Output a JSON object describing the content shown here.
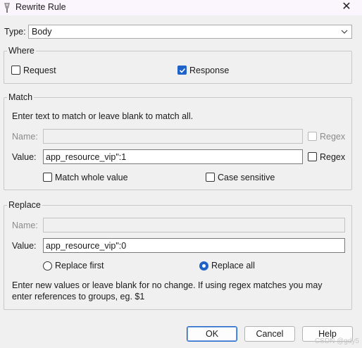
{
  "window": {
    "title": "Rewrite Rule",
    "close_glyph": "✕"
  },
  "type": {
    "label": "Type:",
    "value": "Body"
  },
  "where": {
    "legend": "Where",
    "request": {
      "label": "Request",
      "checked": false
    },
    "response": {
      "label": "Response",
      "checked": true
    }
  },
  "match": {
    "legend": "Match",
    "hint": "Enter text to match or leave blank to match all.",
    "name_label": "Name:",
    "name_value": "",
    "name_regex": {
      "label": "Regex",
      "checked": false,
      "enabled": false
    },
    "value_label": "Value:",
    "value_value": "app_resource_vip\":1",
    "value_regex": {
      "label": "Regex",
      "checked": false
    },
    "whole_value": {
      "label": "Match whole value",
      "checked": false
    },
    "case_sensitive": {
      "label": "Case sensitive",
      "checked": false
    }
  },
  "replace": {
    "legend": "Replace",
    "name_label": "Name:",
    "name_value": "",
    "value_label": "Value:",
    "value_value": "app_resource_vip\":0",
    "replace_first": {
      "label": "Replace first",
      "selected": false
    },
    "replace_all": {
      "label": "Replace all",
      "selected": true
    },
    "hint_line1": "Enter new values or leave blank for no change. If using regex matches you may",
    "hint_line2": "enter references to groups, eg. $1"
  },
  "buttons": {
    "ok": "OK",
    "cancel": "Cancel",
    "help": "Help"
  },
  "watermark": "CSDN @gdy5",
  "colors": {
    "accent": "#1f63c8",
    "background": "#f0f0f0",
    "titlebar": "#fbf6fd"
  },
  "icons": {
    "app": "wand-icon",
    "close": "close-icon",
    "dropdown": "chevron-down-icon"
  }
}
